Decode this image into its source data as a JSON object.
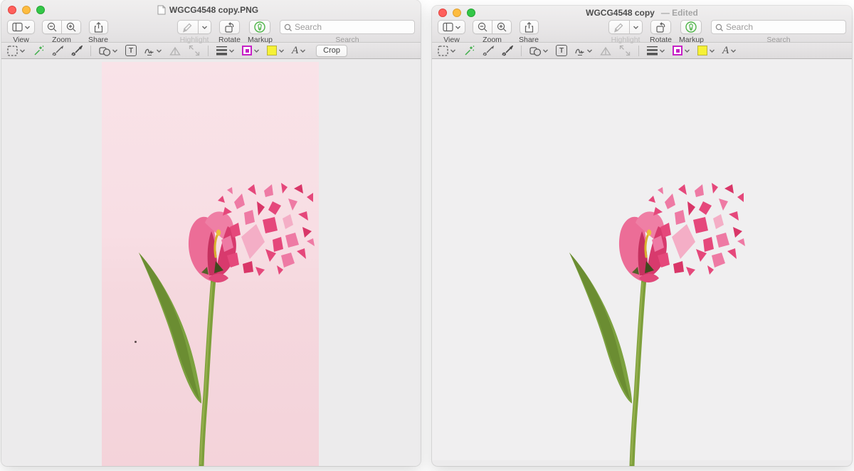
{
  "windows": [
    {
      "title": "WGCG4548 copy.PNG",
      "edited_suffix": "",
      "toolbar": {
        "view_label": "View",
        "zoom_label": "Zoom",
        "share_label": "Share",
        "highlight_label": "Highlight",
        "rotate_label": "Rotate",
        "markup_label": "Markup",
        "search_placeholder": "Search",
        "search_label": "Search"
      },
      "markup_bar": {
        "text_tool_glyph": "T",
        "text_style_glyph": "A",
        "crop_label": "Crop"
      }
    },
    {
      "title": "WGCG4548 copy",
      "edited_suffix": "— Edited",
      "toolbar": {
        "view_label": "View",
        "zoom_label": "Zoom",
        "share_label": "Share",
        "highlight_label": "Highlight",
        "rotate_label": "Rotate",
        "markup_label": "Markup",
        "search_placeholder": "Search",
        "search_label": "Search"
      },
      "markup_bar": {
        "text_tool_glyph": "T",
        "text_style_glyph": "A"
      }
    }
  ],
  "colors": {
    "traffic_red": "#ff605c",
    "traffic_yellow": "#fdbc40",
    "traffic_green": "#33c748",
    "markup_icon_green": "#4eb548",
    "magic_wand_green": "#3fae49",
    "border_color_swatch": "#c621c6",
    "fill_color_swatch": "#f6f136",
    "photo_background_pink": "#f7dde2",
    "tulip_pink": "#e5487b",
    "stem_green": "#7d9f3b"
  }
}
